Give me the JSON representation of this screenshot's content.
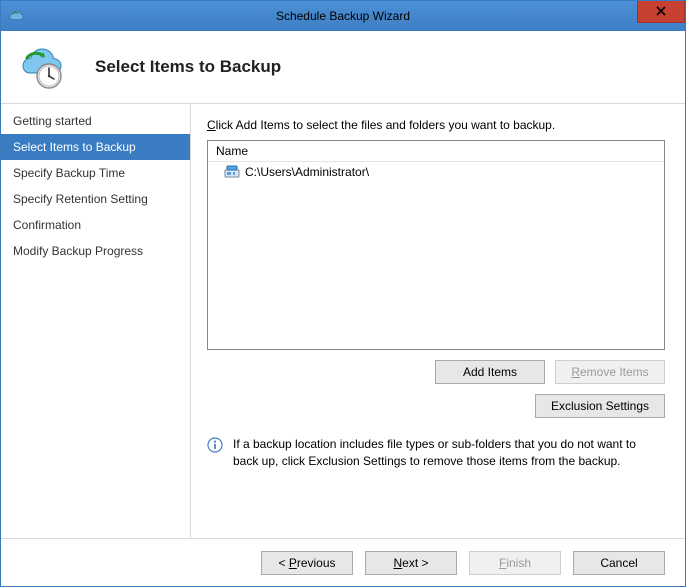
{
  "window": {
    "title": "Schedule Backup Wizard"
  },
  "header": {
    "title": "Select Items to Backup"
  },
  "sidebar": {
    "items": [
      {
        "label": "Getting started",
        "active": false
      },
      {
        "label": "Select Items to Backup",
        "active": true
      },
      {
        "label": "Specify Backup Time",
        "active": false
      },
      {
        "label": "Specify Retention Setting",
        "active": false
      },
      {
        "label": "Confirmation",
        "active": false
      },
      {
        "label": "Modify Backup Progress",
        "active": false
      }
    ]
  },
  "content": {
    "instruction_prefix": "C",
    "instruction_rest": "lick Add Items to select the files and folders you want to backup.",
    "list": {
      "header": "Name",
      "items": [
        {
          "path": "C:\\Users\\Administrator\\"
        }
      ]
    },
    "buttons": {
      "add_items": "Add Items",
      "remove_items_prefix": "R",
      "remove_items_rest": "emove Items",
      "exclusion_settings": "Exclusion Settings"
    },
    "info_text": "If a backup location includes file types or sub-folders that you do not want to back up, click Exclusion Settings to remove those items from the backup."
  },
  "footer": {
    "previous_prefix": "< ",
    "previous_u": "P",
    "previous_rest": "revious",
    "next_u": "N",
    "next_rest": "ext >",
    "finish_u": "F",
    "finish_rest": "inish",
    "cancel": "Cancel"
  }
}
